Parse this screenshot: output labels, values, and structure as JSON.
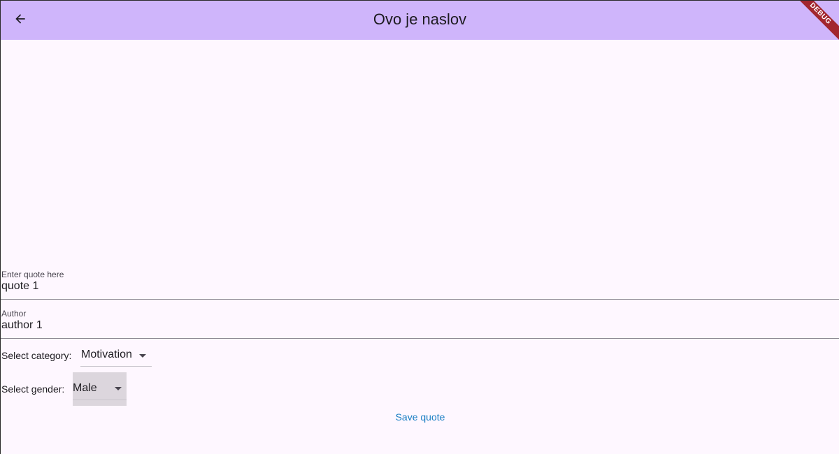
{
  "appbar": {
    "title": "Ovo je naslov",
    "back_icon": "arrow-left-icon",
    "color": "#cfb5fb"
  },
  "debug_banner": {
    "label": "DEBUG",
    "color": "#a2262e"
  },
  "form": {
    "quote": {
      "label": "Enter quote here",
      "value": "quote 1"
    },
    "author": {
      "label": "Author",
      "value": "author 1"
    },
    "category": {
      "label": "Select category:",
      "selected": "Motivation"
    },
    "gender": {
      "label": "Select gender:",
      "selected": "Male"
    },
    "save_label": "Save quote"
  },
  "colors": {
    "background": "#fef7ff",
    "link": "#1a7fc4"
  }
}
